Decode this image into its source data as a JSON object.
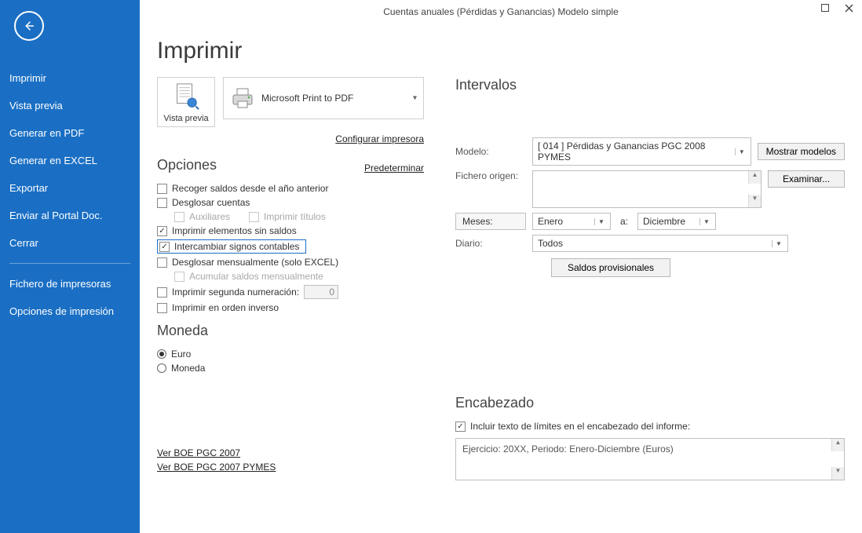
{
  "window_title": "Cuentas anuales (Pérdidas y Ganancias) Modelo simple",
  "sidebar": {
    "items": [
      "Imprimir",
      "Vista previa",
      "Generar en PDF",
      "Generar en EXCEL",
      "Exportar",
      "Enviar al Portal Doc.",
      "Cerrar"
    ],
    "secondary": [
      "Fichero de impresoras",
      "Opciones de impresión"
    ]
  },
  "page_heading": "Imprimir",
  "preview_button_label": "Vista previa",
  "printer_selected": "Microsoft Print to PDF",
  "link_configure_printer": "Configurar impresora",
  "link_default": "Predeterminar",
  "options_heading": "Opciones",
  "options": {
    "recoger_saldos": "Recoger saldos desde el año anterior",
    "desglosar_cuentas": "Desglosar cuentas",
    "auxiliares": "Auxiliares",
    "imprimir_titulos": "Imprimir títulos",
    "imprimir_sin_saldos": "Imprimir elementos sin saldos",
    "intercambiar_signos": "Intercambiar signos contables",
    "desglosar_mensual": "Desglosar mensualmente (solo EXCEL)",
    "acumular_mensual": "Acumular saldos mensualmente",
    "segunda_numeracion": "Imprimir segunda numeración:",
    "segunda_numeracion_value": "0",
    "orden_inverso": "Imprimir en orden inverso"
  },
  "moneda_heading": "Moneda",
  "moneda": {
    "euro": "Euro",
    "moneda": "Moneda"
  },
  "boe_links": {
    "pgc2007": "Ver BOE PGC 2007",
    "pgc2007_pymes": "Ver BOE PGC 2007 PYMES"
  },
  "intervals_heading": "Intervalos",
  "labels": {
    "modelo": "Modelo:",
    "fichero_origen": "Fichero origen:",
    "meses": "Meses:",
    "a": "a:",
    "diario": "Diario:"
  },
  "modelo_value": "[ 014 ] Pérdidas y Ganancias PGC 2008 PYMES",
  "btn_mostrar_modelos": "Mostrar modelos",
  "btn_examinar": "Examinar...",
  "mes_desde": "Enero",
  "mes_hasta": "Diciembre",
  "diario_value": "Todos",
  "btn_saldos_prov": "Saldos provisionales",
  "encabezado_heading": "Encabezado",
  "encabezado_check_label": "Incluir texto de límites en el encabezado del informe:",
  "encabezado_text": "Ejercicio: 20XX, Periodo: Enero-Diciembre (Euros)"
}
